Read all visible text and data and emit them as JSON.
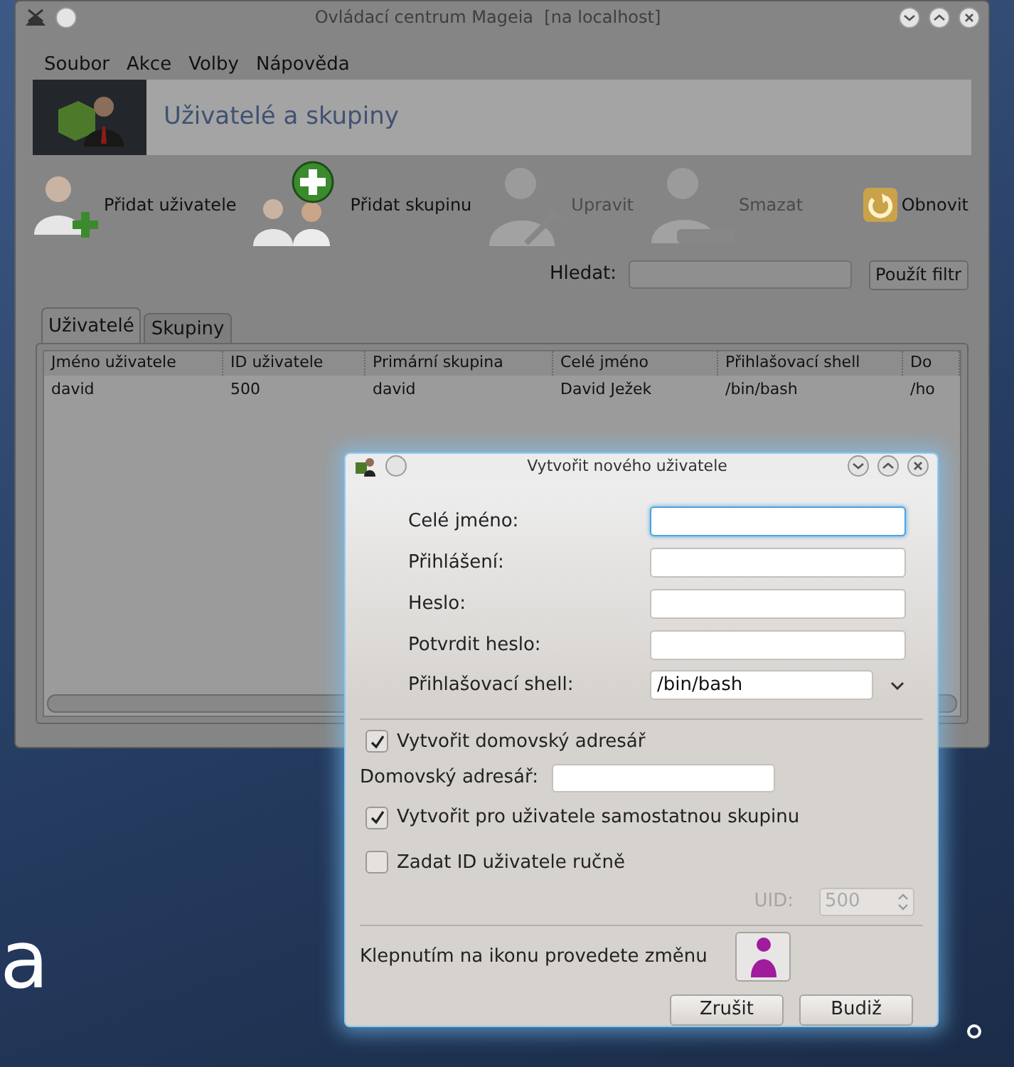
{
  "main_window": {
    "title": "Ovládací centrum Mageia  [na localhost]",
    "menu": [
      "Soubor",
      "Akce",
      "Volby",
      "Nápověda"
    ],
    "banner": {
      "title": "Uživatelé a skupiny"
    },
    "toolbar": [
      {
        "kind": "add-user",
        "label": "Přidat uživatele",
        "disabled": false
      },
      {
        "kind": "add-group",
        "label": "Přidat skupinu",
        "disabled": false
      },
      {
        "kind": "edit",
        "label": "Upravit",
        "disabled": true
      },
      {
        "kind": "delete",
        "label": "Smazat",
        "disabled": true
      },
      {
        "kind": "refresh",
        "label": "Obnovit",
        "disabled": false
      }
    ],
    "search": {
      "label": "Hledat:",
      "button": "Použít filtr"
    },
    "tabs": [
      {
        "label": "Uživatelé",
        "selected": true
      },
      {
        "label": "Skupiny",
        "selected": false
      }
    ],
    "table": {
      "columns": [
        "Jméno uživatele",
        "ID uživatele",
        "Primární skupina",
        "Celé jméno",
        "Přihlašovací shell",
        "Do"
      ],
      "rows": [
        [
          "david",
          "500",
          "david",
          "David Ježek",
          "/bin/bash",
          "/ho"
        ]
      ]
    }
  },
  "dialog": {
    "title": "Vytvořit nového uživatele",
    "fields": [
      {
        "label": "Celé jméno:",
        "focused": true
      },
      {
        "label": "Přihlášení:",
        "focused": false
      },
      {
        "label": "Heslo:",
        "focused": false
      },
      {
        "label": "Potvrdit heslo:",
        "focused": false
      }
    ],
    "shell": {
      "label": "Přihlašovací shell:",
      "value": "/bin/bash"
    },
    "create_home": {
      "label": "Vytvořit domovský adresář",
      "checked": true
    },
    "home_dir": {
      "label": "Domovský adresář:"
    },
    "private_group": {
      "label": "Vytvořit pro uživatele samostatnou skupinu",
      "checked": true
    },
    "manual_uid": {
      "label": "Zadat ID uživatele ručně",
      "checked": false
    },
    "uid": {
      "label": "UID:",
      "value": "500",
      "disabled": true
    },
    "icon_hint": "Klepnutím na ikonu provedete změnu",
    "buttons": [
      "Zrušit",
      "Budiž"
    ]
  },
  "wallpaper": {
    "text": "a"
  }
}
